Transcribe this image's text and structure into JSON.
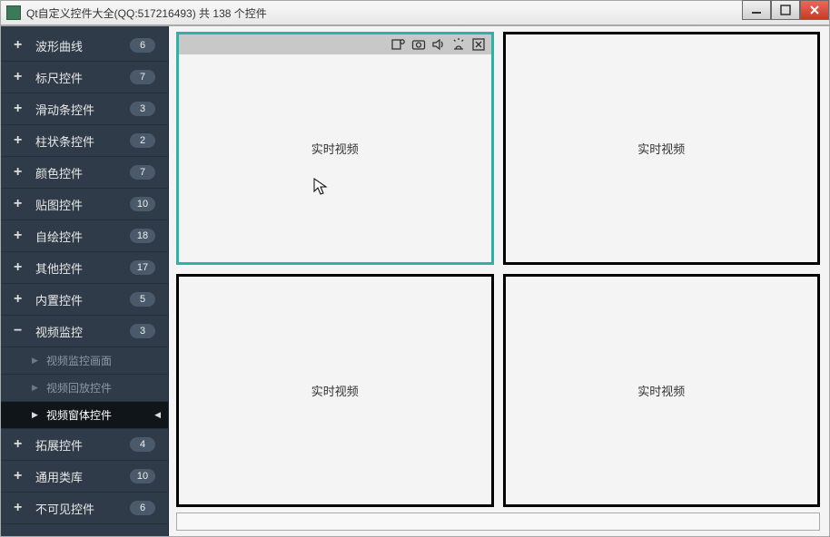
{
  "window": {
    "title": "Qt自定义控件大全(QQ:517216493) 共 138 个控件"
  },
  "sidebar": {
    "items": [
      {
        "type": "cat",
        "expander": "+",
        "label": "波形曲线",
        "count": "6"
      },
      {
        "type": "cat",
        "expander": "+",
        "label": "标尺控件",
        "count": "7"
      },
      {
        "type": "cat",
        "expander": "+",
        "label": "滑动条控件",
        "count": "3"
      },
      {
        "type": "cat",
        "expander": "+",
        "label": "柱状条控件",
        "count": "2"
      },
      {
        "type": "cat",
        "expander": "+",
        "label": "颜色控件",
        "count": "7"
      },
      {
        "type": "cat",
        "expander": "+",
        "label": "贴图控件",
        "count": "10"
      },
      {
        "type": "cat",
        "expander": "+",
        "label": "自绘控件",
        "count": "18"
      },
      {
        "type": "cat",
        "expander": "+",
        "label": "其他控件",
        "count": "17"
      },
      {
        "type": "cat",
        "expander": "+",
        "label": "内置控件",
        "count": "5"
      },
      {
        "type": "cat",
        "expander": "−",
        "label": "视频监控",
        "count": "3"
      },
      {
        "type": "sub",
        "label": "视频监控画面",
        "selected": false
      },
      {
        "type": "sub",
        "label": "视频回放控件",
        "selected": false
      },
      {
        "type": "sub",
        "label": "视频窗体控件",
        "selected": true
      },
      {
        "type": "cat",
        "expander": "+",
        "label": "拓展控件",
        "count": "4"
      },
      {
        "type": "cat",
        "expander": "+",
        "label": "通用类库",
        "count": "10"
      },
      {
        "type": "cat",
        "expander": "+",
        "label": "不可见控件",
        "count": "6"
      }
    ]
  },
  "video": {
    "cell_label": "实时视频",
    "icons": [
      "record-icon",
      "snapshot-icon",
      "audio-icon",
      "alarm-icon",
      "close-icon"
    ]
  }
}
